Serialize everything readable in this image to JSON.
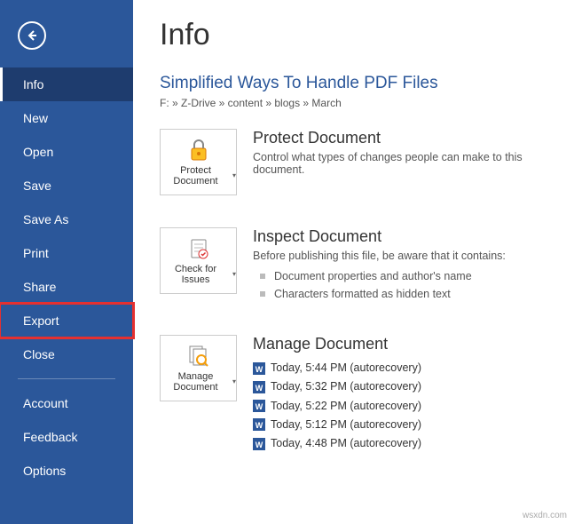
{
  "sidebar": {
    "items": [
      {
        "label": "Info",
        "selected": true
      },
      {
        "label": "New"
      },
      {
        "label": "Open"
      },
      {
        "label": "Save"
      },
      {
        "label": "Save As"
      },
      {
        "label": "Print"
      },
      {
        "label": "Share"
      },
      {
        "label": "Export",
        "highlighted": true
      },
      {
        "label": "Close"
      }
    ],
    "footer": [
      {
        "label": "Account"
      },
      {
        "label": "Feedback"
      },
      {
        "label": "Options"
      }
    ]
  },
  "main": {
    "page_title": "Info",
    "doc_title": "Simplified Ways To Handle PDF Files",
    "breadcrumb": "F: » Z-Drive » content » blogs » March",
    "sections": {
      "protect": {
        "tile_label": "Protect Document",
        "title": "Protect Document",
        "desc": "Control what types of changes people can make to this document."
      },
      "inspect": {
        "tile_label": "Check for Issues",
        "title": "Inspect Document",
        "desc": "Before publishing this file, be aware that it contains:",
        "bullets": [
          "Document properties and author's name",
          "Characters formatted as hidden text"
        ]
      },
      "manage": {
        "tile_label": "Manage Document",
        "title": "Manage Document",
        "versions": [
          "Today, 5:44 PM (autorecovery)",
          "Today, 5:32 PM (autorecovery)",
          "Today, 5:22 PM (autorecovery)",
          "Today, 5:12 PM (autorecovery)",
          "Today, 4:48 PM (autorecovery)"
        ]
      }
    }
  },
  "watermark": "wsxdn.com"
}
